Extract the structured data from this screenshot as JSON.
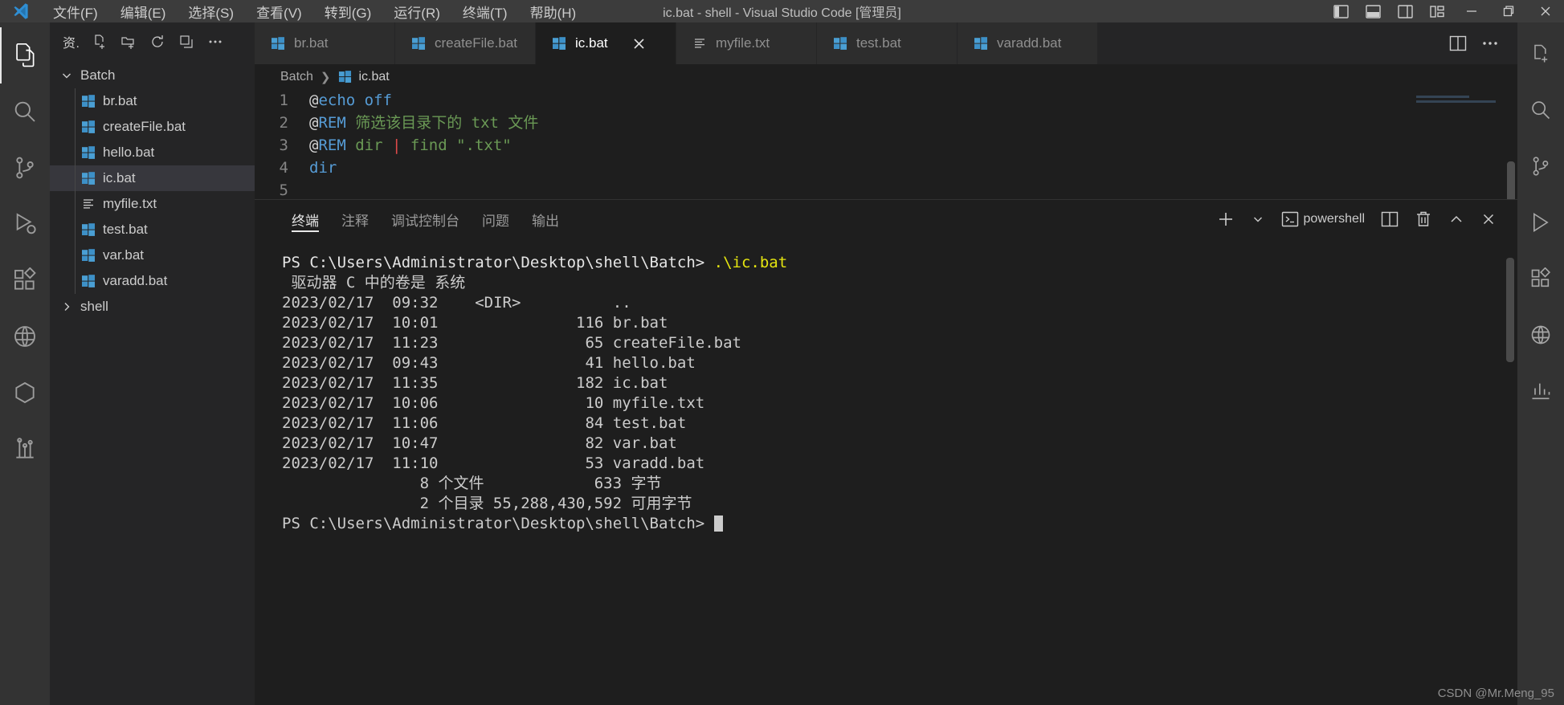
{
  "window": {
    "title": "ic.bat - shell - Visual Studio Code [管理员]",
    "menus": [
      "文件(F)",
      "编辑(E)",
      "选择(S)",
      "查看(V)",
      "转到(G)",
      "运行(R)",
      "终端(T)",
      "帮助(H)"
    ],
    "layout_buttons": [
      "toggle-primary-sidebar",
      "toggle-panel",
      "toggle-secondary-sidebar",
      "customize-layout"
    ],
    "controls": {
      "minimize": "—",
      "maximize": "▢",
      "close": "✕"
    }
  },
  "activitybar": {
    "items": [
      {
        "name": "explorer",
        "icon": "files-icon",
        "active": true
      },
      {
        "name": "search",
        "icon": "search-icon",
        "active": false
      },
      {
        "name": "source-control",
        "icon": "source-control-icon",
        "active": false
      },
      {
        "name": "run-and-debug",
        "icon": "debug-icon",
        "active": false
      },
      {
        "name": "extensions",
        "icon": "extensions-icon",
        "active": false
      },
      {
        "name": "remote-explorer",
        "icon": "remote-icon",
        "active": false
      },
      {
        "name": "docker",
        "icon": "docker-icon",
        "active": false
      },
      {
        "name": "testing",
        "icon": "beaker-icon",
        "active": false
      }
    ]
  },
  "sidebar": {
    "header_title": "资.",
    "header_actions": [
      "new-file-icon",
      "new-folder-icon",
      "refresh-icon",
      "collapse-all-icon",
      "more-actions-icon"
    ],
    "tree": [
      {
        "label": "Batch",
        "type": "folder",
        "expanded": true,
        "icon": "chevron-down-icon",
        "selected": false
      },
      {
        "label": "br.bat",
        "type": "file",
        "icon": "batch-file-icon",
        "selected": false
      },
      {
        "label": "createFile.bat",
        "type": "file",
        "icon": "batch-file-icon",
        "selected": false
      },
      {
        "label": "hello.bat",
        "type": "file",
        "icon": "batch-file-icon",
        "selected": false
      },
      {
        "label": "ic.bat",
        "type": "file",
        "icon": "batch-file-icon",
        "selected": true
      },
      {
        "label": "myfile.txt",
        "type": "file",
        "icon": "text-file-icon",
        "selected": false
      },
      {
        "label": "test.bat",
        "type": "file",
        "icon": "batch-file-icon",
        "selected": false
      },
      {
        "label": "var.bat",
        "type": "file",
        "icon": "batch-file-icon",
        "selected": false
      },
      {
        "label": "varadd.bat",
        "type": "file",
        "icon": "batch-file-icon",
        "selected": false
      },
      {
        "label": "shell",
        "type": "folder",
        "expanded": false,
        "icon": "chevron-right-icon",
        "selected": false
      }
    ]
  },
  "editor": {
    "tabs": [
      {
        "label": "br.bat",
        "icon": "batch-file-icon",
        "active": false,
        "closable": false
      },
      {
        "label": "createFile.bat",
        "icon": "batch-file-icon",
        "active": false,
        "closable": false
      },
      {
        "label": "ic.bat",
        "icon": "batch-file-icon",
        "active": true,
        "closable": true
      },
      {
        "label": "myfile.txt",
        "icon": "text-file-icon",
        "active": false,
        "closable": false
      },
      {
        "label": "test.bat",
        "icon": "batch-file-icon",
        "active": false,
        "closable": false
      },
      {
        "label": "varadd.bat",
        "icon": "batch-file-icon",
        "active": false,
        "closable": false
      }
    ],
    "tab_actions": [
      "split-editor-icon",
      "more-actions-icon"
    ],
    "breadcrumb": {
      "folder": "Batch",
      "separator": "❯",
      "file": "ic.bat"
    },
    "lines": [
      {
        "n": "1",
        "tokens": [
          {
            "t": "@",
            "c": "plain"
          },
          {
            "t": "echo off",
            "c": "blue"
          }
        ]
      },
      {
        "n": "2",
        "tokens": [
          {
            "t": "@",
            "c": "plain"
          },
          {
            "t": "REM",
            "c": "blue"
          },
          {
            "t": " 筛选该目录下的 txt 文件",
            "c": "green"
          }
        ]
      },
      {
        "n": "3",
        "tokens": [
          {
            "t": "@",
            "c": "plain"
          },
          {
            "t": "REM",
            "c": "blue"
          },
          {
            "t": " dir ",
            "c": "green"
          },
          {
            "t": "|",
            "c": "red"
          },
          {
            "t": " find \".txt\"",
            "c": "green"
          }
        ]
      },
      {
        "n": "4",
        "tokens": [
          {
            "t": "dir",
            "c": "blue"
          }
        ]
      },
      {
        "n": "5",
        "tokens": [
          {
            "t": "",
            "c": "plain"
          }
        ]
      }
    ],
    "annotation": {
      "type": "red-box",
      "target_line": "4",
      "color": "#ee2020"
    }
  },
  "panel": {
    "tabs": [
      "终端",
      "注释",
      "调试控制台",
      "问题",
      "输出"
    ],
    "active_tab": "终端",
    "actions": {
      "new_terminal": "+",
      "dropdown": "⌄",
      "shell_name": "powershell",
      "shell_icon": "terminal-icon",
      "split": "split-terminal-icon",
      "kill": "trash-icon",
      "maximize": "chevron-up-icon",
      "close": "close-icon"
    }
  },
  "terminal": {
    "prompt_path": "PS C:\\Users\\Administrator\\Desktop\\shell\\Batch>",
    "command": " .\\ic.bat",
    "lines": [
      " 驱动器 C 中的卷是 系统",
      "2023/02/17  09:32    <DIR>          ..",
      "2023/02/17  10:01               116 br.bat",
      "2023/02/17  11:23                65 createFile.bat",
      "2023/02/17  09:43                41 hello.bat",
      "2023/02/17  11:35               182 ic.bat",
      "2023/02/17  10:06                10 myfile.txt",
      "2023/02/17  11:06                84 test.bat",
      "2023/02/17  10:47                82 var.bat",
      "2023/02/17  11:10                53 varadd.bat",
      "               8 个文件            633 字节",
      "               2 个目录 55,288,430,592 可用字节"
    ],
    "final_prompt": "PS C:\\Users\\Administrator\\Desktop\\shell\\Batch>"
  },
  "rightbar": {
    "items": [
      "new-file-icon",
      "search-icon",
      "source-control-icon",
      "run-icon",
      "extensions-icon",
      "remote-icon",
      "graph-icon"
    ]
  },
  "watermark": "CSDN @Mr.Meng_95",
  "colors": {
    "accent_blue": "#569cd6",
    "comment_green": "#6a9955",
    "annotation_red": "#ee2020",
    "terminal_yellow": "#e5e510",
    "file_icon_blue": "#4a9fd4"
  }
}
